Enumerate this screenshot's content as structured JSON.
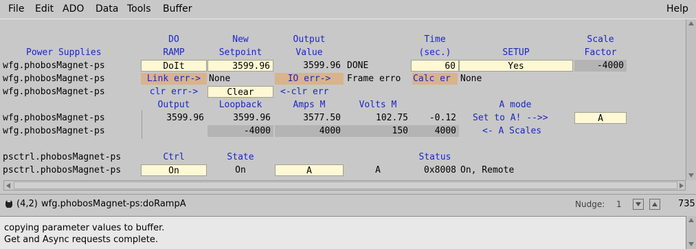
{
  "menu": {
    "file": "File",
    "edit": "Edit",
    "ado": "ADO",
    "data": "Data",
    "tools": "Tools",
    "buffer": "Buffer",
    "help": "Help"
  },
  "headers1": {
    "power_supplies": "Power Supplies",
    "do_ramp_1": "DO",
    "do_ramp_2": "RAMP",
    "new_setpoint_1": "New",
    "new_setpoint_2": "Setpoint",
    "output_value_1": "Output",
    "output_value_2": "Value",
    "time_1": "Time",
    "time_2": "(sec.)",
    "setup": "SETUP",
    "scale_1": "Scale",
    "scale_2": "Factor"
  },
  "rows": {
    "r1": {
      "label": "wfg.phobosMagnet-ps",
      "doit": "DoIt",
      "setpoint": "3599.96",
      "output": "3599.96",
      "status": "DONE",
      "time": "60",
      "setup": "Yes",
      "scale": "-4000"
    },
    "r2": {
      "label": "wfg.phobosMagnet-ps",
      "link_err": "Link err->",
      "link_val": "None",
      "io_err": "IO err->",
      "frame_err": "Frame erro",
      "calc_err": "Calc er",
      "calc_val": "None"
    },
    "r3": {
      "label": "wfg.phobosMagnet-ps",
      "clr_err": "clr err->",
      "clear": "Clear",
      "clr_err_back": "<-clr err"
    }
  },
  "headers2": {
    "output": "Output",
    "loopback": "Loopback",
    "amps_m": "Amps M",
    "volts_m": "Volts M",
    "a_mode": "A mode"
  },
  "rows2": {
    "r4": {
      "label": "wfg.phobosMagnet-ps",
      "output": "3599.96",
      "loopback": "3599.96",
      "amps": "3577.50",
      "volts": "102.75",
      "extra": "-0.12",
      "set_to_a": "Set to A! -->>",
      "a_value": "A"
    },
    "r5": {
      "label": "wfg.phobosMagnet-ps",
      "v1": "-4000",
      "v2": "4000",
      "v3": "150",
      "v4": "4000",
      "a_scales": "<- A Scales"
    }
  },
  "headers3": {
    "ctrl": "Ctrl",
    "state": "State",
    "status": "Status"
  },
  "rows3": {
    "r6": {
      "label": "psctrl.phobosMagnet-ps"
    },
    "r7": {
      "label": "psctrl.phobosMagnet-ps",
      "ctrl": "On",
      "state": "On",
      "a1": "A",
      "a2": "A",
      "status_code": "0x8008",
      "status_text": "On, Remote"
    }
  },
  "statusbar": {
    "position": "(4,2)",
    "path": "wfg.phobosMagnet-ps:doRampA",
    "nudge_label": "Nudge:",
    "nudge_value": "1",
    "count": "735"
  },
  "messages": {
    "line1": "copying parameter values to buffer.",
    "line2": "Get and Async requests complete."
  }
}
